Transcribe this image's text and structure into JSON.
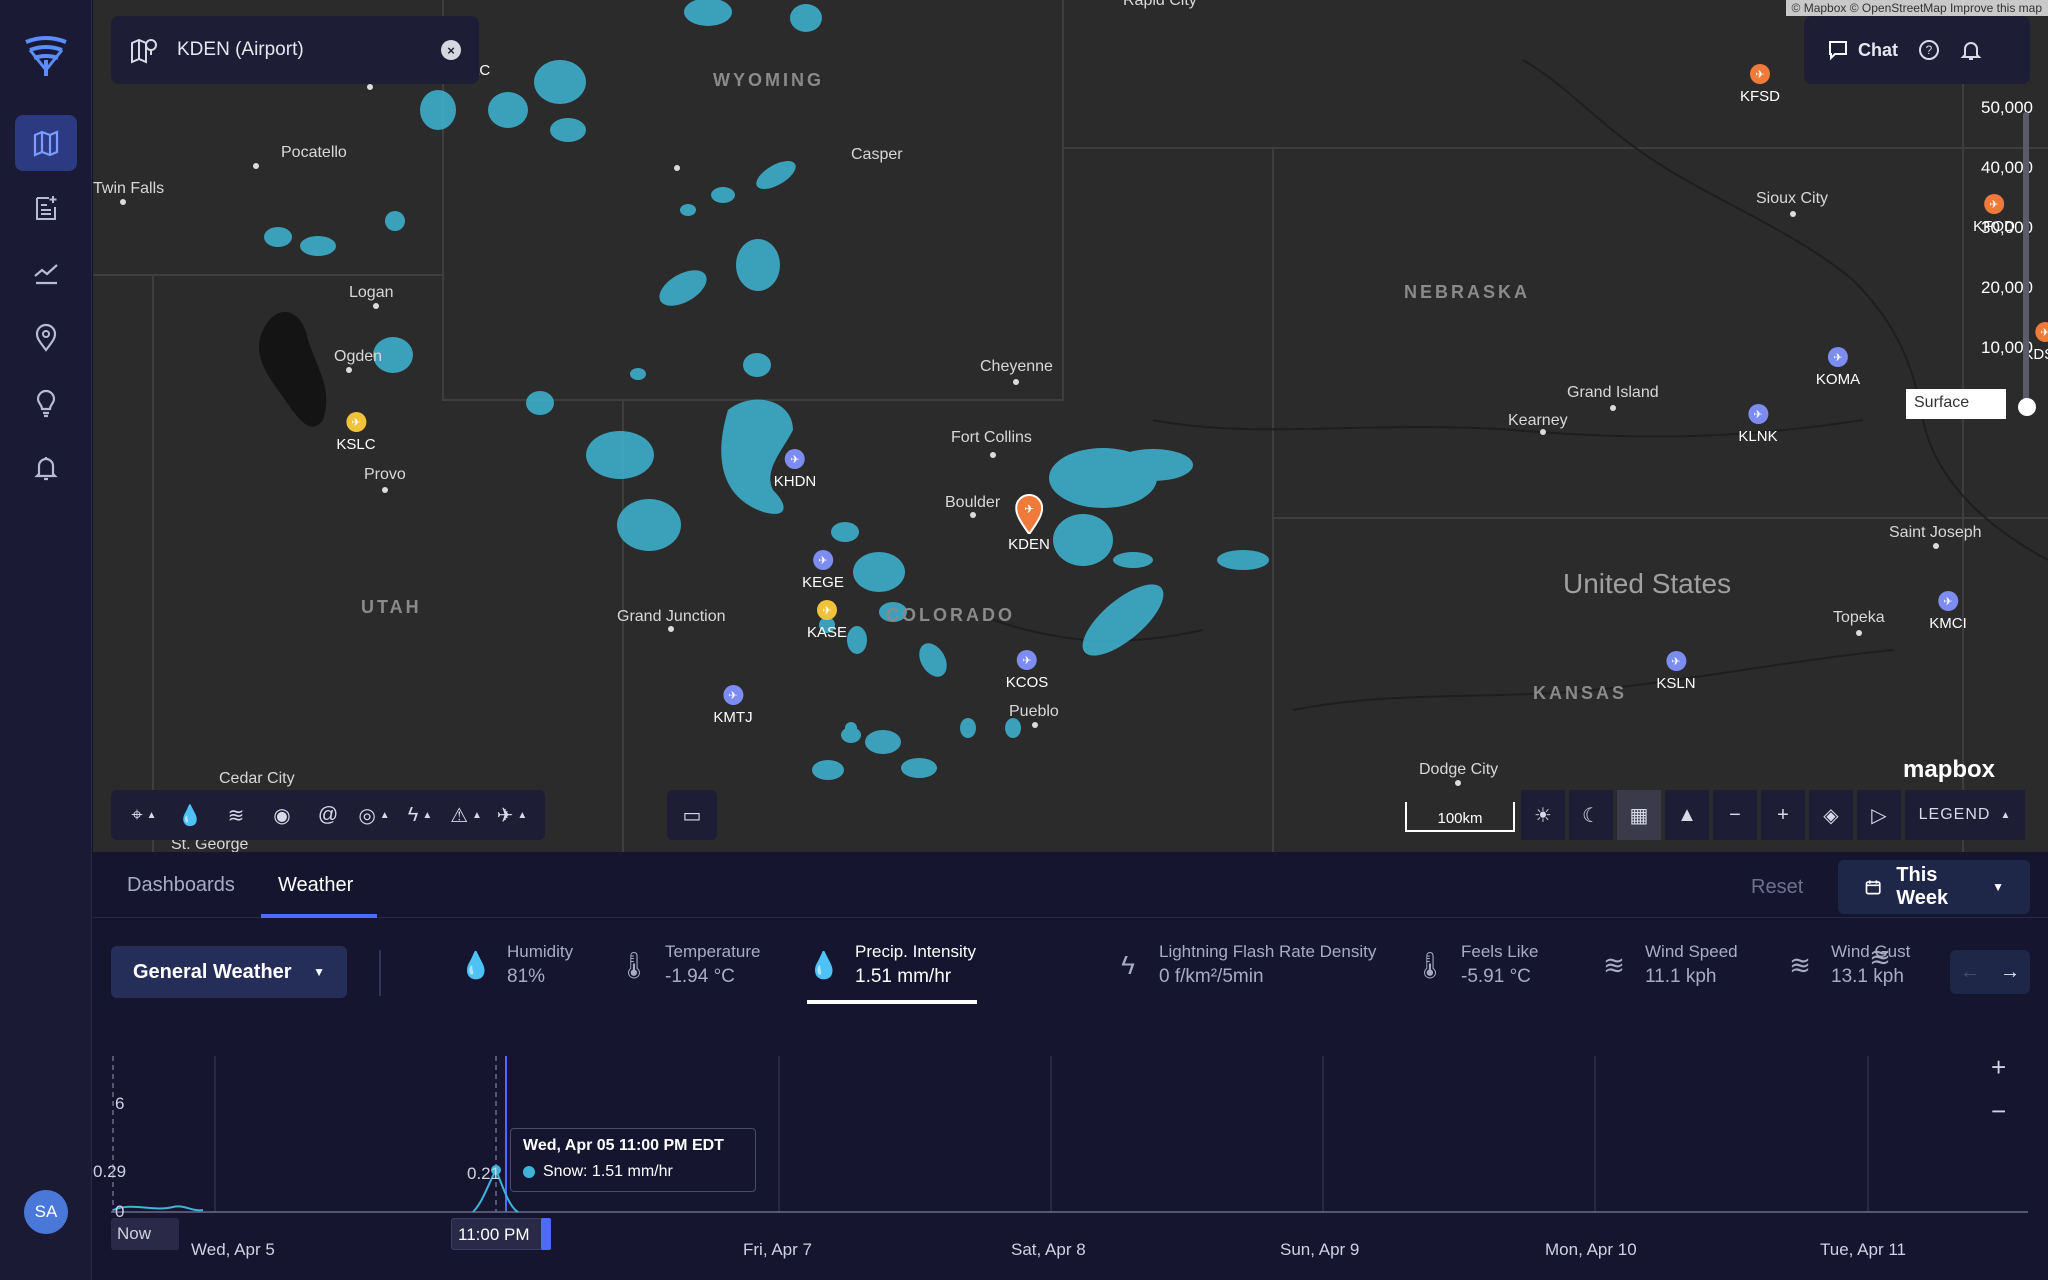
{
  "sidebar": {
    "items": [
      {
        "name": "map"
      },
      {
        "name": "reports"
      },
      {
        "name": "analytics"
      },
      {
        "name": "locations"
      },
      {
        "name": "insights"
      },
      {
        "name": "alerts"
      }
    ],
    "avatar_initials": "SA"
  },
  "map": {
    "search_value": "KDEN (Airport)",
    "attribution": "© Mapbox © OpenStreetMap Improve this map",
    "chat_label": "Chat",
    "altitude_ticks": [
      "50,000",
      "40,000",
      "30,000",
      "20,000",
      "10,000"
    ],
    "surface_label": "Surface",
    "scale_label": "100km",
    "legend_label": "LEGEND",
    "mapbox_label": "mapbox",
    "state_labels": [
      "WYOMING",
      "NEBRASKA",
      "UTAH",
      "COLORADO",
      "KANSAS"
    ],
    "country_label": "United States",
    "cities": [
      "Rapid City",
      "Twin Falls",
      "Pocatello",
      "Casper",
      "Sioux City",
      "Logan",
      "Ogden",
      "Cheyenne",
      "Grand Island",
      "Kearney",
      "Fort Collins",
      "Provo",
      "Boulder",
      "Saint Joseph",
      "Grand Junction",
      "Topeka",
      "Pueblo",
      "Dodge City",
      "Cedar City",
      "St. George"
    ],
    "airports": [
      "KJAC",
      "KFSD",
      "KFOD",
      "KDSM",
      "KOMA",
      "KLNK",
      "KSLC",
      "KHDN",
      "KDEN",
      "KEGE",
      "KASE",
      "KMCI",
      "KSLN",
      "KCOS",
      "KMTJ"
    ]
  },
  "panel": {
    "tabs": [
      "Dashboards",
      "Weather"
    ],
    "active_tab": "Weather",
    "reset_label": "Reset",
    "range_label": "This Week",
    "dataset_label": "General Weather",
    "metrics": [
      {
        "label": "Humidity",
        "value": "81%",
        "icon": "humidity-icon"
      },
      {
        "label": "Temperature",
        "value": "-1.94 °C",
        "icon": "thermometer-icon"
      },
      {
        "label": "Precip. Intensity",
        "value": "1.51 mm/hr",
        "icon": "precip-icon"
      },
      {
        "label": "Lightning Flash Rate Density",
        "value": "0 f/km²/5min",
        "icon": "lightning-icon"
      },
      {
        "label": "Feels Like",
        "value": "-5.91 °C",
        "icon": "feels-like-icon"
      },
      {
        "label": "Wind Speed",
        "value": "11.1 kph",
        "icon": "wind-icon"
      },
      {
        "label": "Wind Gust",
        "value": "13.1 kph",
        "icon": "wind-gust-icon"
      }
    ],
    "active_metric": "Precip. Intensity"
  },
  "chart_data": {
    "type": "line",
    "y_ticks": [
      "6",
      "0"
    ],
    "x_labels": [
      "Wed, Apr 5",
      "Fri, Apr 7",
      "Sat, Apr 8",
      "Sun, Apr 9",
      "Mon, Apr 10",
      "Tue, Apr 11"
    ],
    "now_label": "Now",
    "cursor_label": "11:00 PM",
    "point_labels": [
      "0.29",
      "0.21"
    ],
    "series": [
      {
        "name": "Snow",
        "values": [
          0.29,
          0.05,
          0.21,
          1.51,
          0.0
        ]
      }
    ],
    "tooltip": {
      "title": "Wed, Apr 05 11:00 PM EDT",
      "line": "Snow: 1.51 mm/hr"
    }
  }
}
